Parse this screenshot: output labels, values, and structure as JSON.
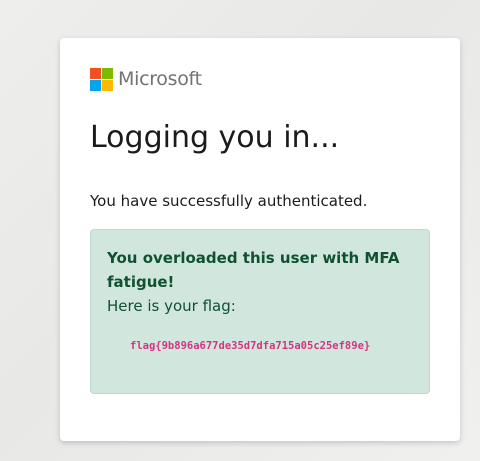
{
  "brand": {
    "name": "Microsoft",
    "logo_colors": [
      "#f25022",
      "#7fba00",
      "#00a4ef",
      "#ffb900"
    ]
  },
  "page": {
    "title": "Logging you in...",
    "subtitle": "You have successfully authenticated."
  },
  "alert": {
    "heading": "You overloaded this user with MFA fatigue!",
    "text": "Here is your flag:",
    "flag": "flag{9b896a677de35d7dfa715a05c25ef89e}",
    "background": "#d1e7dd",
    "text_color": "#0f5132",
    "flag_color": "#d63384"
  }
}
